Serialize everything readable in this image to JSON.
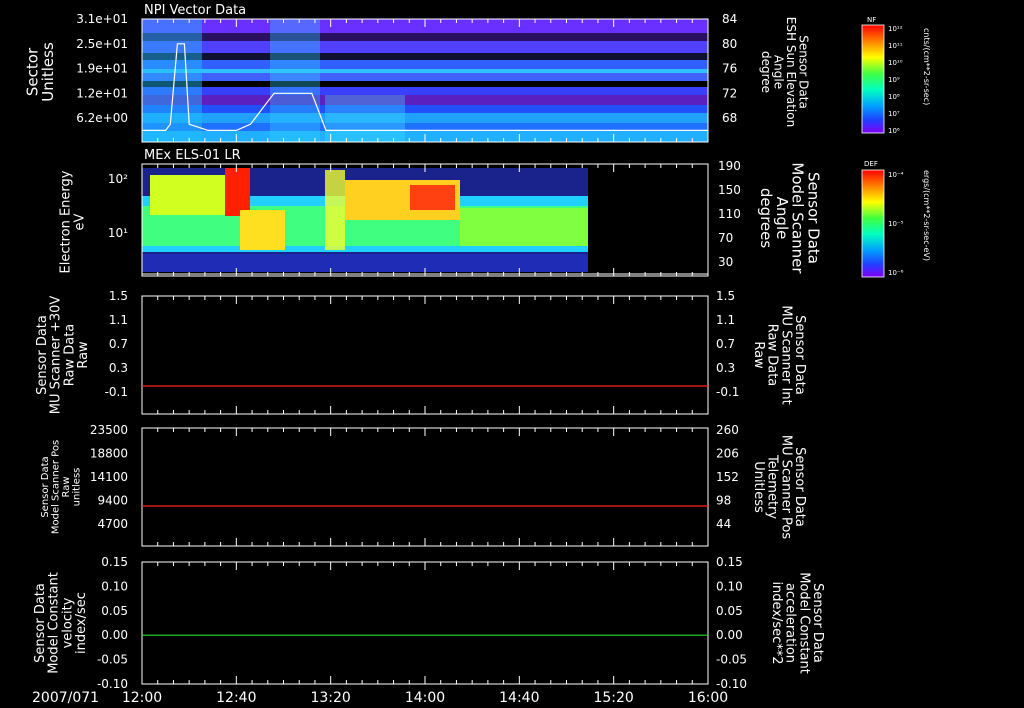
{
  "date_label": "2007/071",
  "x_ticks": [
    "12:00",
    "12:40",
    "13:20",
    "14:00",
    "14:40",
    "15:20",
    "16:00"
  ],
  "colors": {
    "red": "#ff2020",
    "green": "#20e020",
    "white": "#ffffff"
  },
  "chart_data": [
    {
      "id": "npi",
      "type": "heatmap",
      "title": "NPI Vector Data",
      "ylabel_left": [
        "Sector",
        "Unitless"
      ],
      "ylabel_right": [
        "Sensor Data",
        "ESH Sun Elevation",
        "Angle",
        "degree"
      ],
      "left_ticks": [
        "3.1e+01",
        "2.5e+01",
        "1.9e+01",
        "1.2e+01",
        "6.2e+00"
      ],
      "right_ticks": [
        "84",
        "80",
        "76",
        "72",
        "68"
      ],
      "colorbar": {
        "title": "NF",
        "unit": "cnts/(cm**2-sr-sec)",
        "ticks": [
          "10¹²",
          "10¹¹",
          "10¹⁰",
          "10⁹",
          "10⁸",
          "10⁷",
          "10⁶"
        ]
      },
      "overlay_line": {
        "name": "ESH Sun Elevation Angle",
        "x_minutes": [
          0,
          10,
          12,
          15,
          18,
          20,
          28,
          40,
          46,
          52,
          56,
          62,
          66,
          72,
          78,
          90,
          240
        ],
        "y": [
          66,
          66,
          67,
          80,
          80,
          67,
          66,
          66,
          67,
          70,
          72,
          72,
          72,
          72,
          66,
          66,
          66
        ]
      }
    },
    {
      "id": "els",
      "type": "heatmap",
      "title": "MEx ELS-01 LR",
      "ylabel_left": [
        "Electron Energy",
        "eV"
      ],
      "ylabel_right": [
        "Sensor Data",
        "Model Scanner",
        "Angle",
        "degrees"
      ],
      "left_ticks": [
        "10²",
        "10¹"
      ],
      "right_ticks": [
        "190",
        "150",
        "110",
        "70",
        "30"
      ],
      "colorbar": {
        "title": "DEF",
        "unit": "ergs/(cm**2-sr-sec-eV)",
        "ticks": [
          "10⁻⁴",
          "10⁻⁵",
          "10⁻⁶"
        ]
      }
    },
    {
      "id": "mu_raw",
      "type": "line",
      "ylabel_left": [
        "Sensor Data",
        "MU Scanner +30V",
        "Raw Data",
        "Raw"
      ],
      "ylabel_right": [
        "Sensor Data",
        "MU Scanner Int",
        "Raw Data",
        "Raw"
      ],
      "left_ticks": [
        "1.5",
        "1.1",
        "0.7",
        "0.3",
        "-0.1"
      ],
      "right_ticks": [
        "1.5",
        "1.1",
        "0.7",
        "0.3",
        "-0.1"
      ],
      "ylim": [
        -0.3,
        1.5
      ],
      "series": [
        {
          "name": "MU Scanner Int Raw Data",
          "color": "#ff2020",
          "x_minutes": [
            0,
            240
          ],
          "y": [
            0.0,
            0.0
          ]
        }
      ]
    },
    {
      "id": "scan_pos",
      "type": "line",
      "ylabel_left": [
        "Sensor Data",
        "Model Scanner Pos",
        "Raw",
        "unitless"
      ],
      "ylabel_right": [
        "Sensor Data",
        "MU Scanner Pos",
        "Telemetry",
        "Unitless"
      ],
      "left_ticks": [
        "23500",
        "18800",
        "14100",
        "9400",
        "4700"
      ],
      "right_ticks": [
        "260",
        "206",
        "152",
        "98",
        "44"
      ],
      "ylim": [
        0,
        23500
      ],
      "series": [
        {
          "name": "MU Scanner Pos Telemetry",
          "color": "#ff2020",
          "x_minutes": [
            0,
            240
          ],
          "y": [
            8300,
            8300
          ]
        }
      ]
    },
    {
      "id": "model_const",
      "type": "line",
      "ylabel_left": [
        "Sensor Data",
        "Model Constant",
        "velocity",
        "index/sec"
      ],
      "ylabel_right": [
        "Sensor Data",
        "Model Constant",
        "acceleration",
        "index/sec**2"
      ],
      "left_ticks": [
        "0.15",
        "0.10",
        "0.05",
        "0.00",
        "-0.05",
        "-0.10"
      ],
      "right_ticks": [
        "0.15",
        "0.10",
        "0.05",
        "0.00",
        "-0.05",
        "-0.10"
      ],
      "ylim": [
        -0.1,
        0.15
      ],
      "series": [
        {
          "name": "Model Constant acceleration",
          "color": "#20e020",
          "x_minutes": [
            0,
            240
          ],
          "y": [
            0.0,
            0.0
          ]
        }
      ]
    }
  ]
}
